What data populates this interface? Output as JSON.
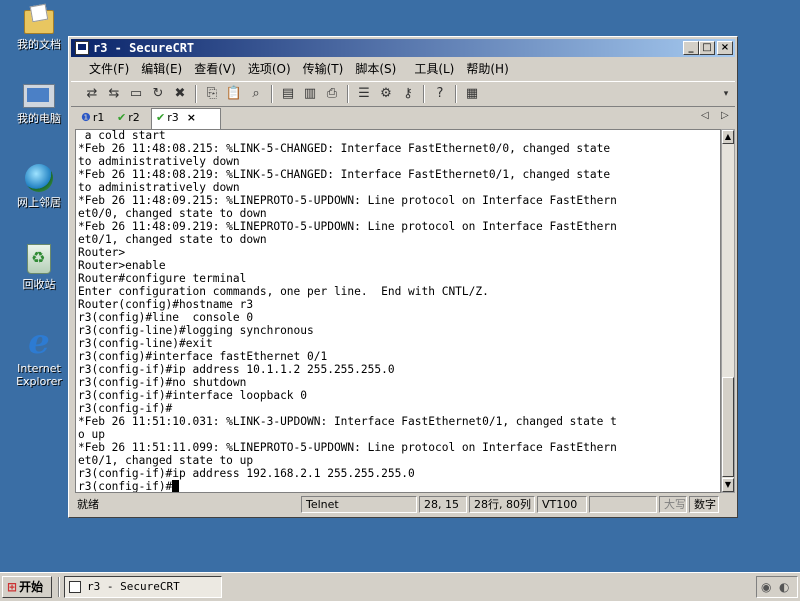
{
  "desktop": {
    "icons": [
      {
        "label": "我的文档",
        "icon": "my-documents-icon"
      },
      {
        "label": "我的电脑",
        "icon": "my-computer-icon"
      },
      {
        "label": "网上邻居",
        "icon": "network-places-icon"
      },
      {
        "label": "回收站",
        "icon": "recycle-bin-icon"
      },
      {
        "label": "Internet Explorer",
        "icon": "internet-explorer-icon"
      }
    ]
  },
  "window": {
    "title": "r3 - SecureCRT",
    "controls": {
      "minimize": "_",
      "maximize": "□",
      "close": "×"
    },
    "menu": [
      "文件(F)",
      "编辑(E)",
      "查看(V)",
      "选项(O)",
      "传输(T)",
      "脚本(S)",
      "工具(L)",
      "帮助(H)"
    ],
    "tabs": [
      {
        "label": "r1",
        "status": "info"
      },
      {
        "label": "r2",
        "status": "connected"
      },
      {
        "label": "r3",
        "status": "connected",
        "active": true,
        "close": "×"
      }
    ],
    "tab_nav": {
      "prev": "◁",
      "next": "▷"
    },
    "terminal_lines": [
      " a cold start",
      "*Feb 26 11:48:08.215: %LINK-5-CHANGED: Interface FastEthernet0/0, changed state",
      "to administratively down",
      "*Feb 26 11:48:08.219: %LINK-5-CHANGED: Interface FastEthernet0/1, changed state",
      "to administratively down",
      "*Feb 26 11:48:09.215: %LINEPROTO-5-UPDOWN: Line protocol on Interface FastEthern",
      "et0/0, changed state to down",
      "*Feb 26 11:48:09.219: %LINEPROTO-5-UPDOWN: Line protocol on Interface FastEthern",
      "et0/1, changed state to down",
      "Router>",
      "Router>enable",
      "Router#configure terminal",
      "Enter configuration commands, one per line.  End with CNTL/Z.",
      "Router(config)#hostname r3",
      "r3(config)#line  console 0",
      "r3(config-line)#logging synchronous",
      "r3(config-line)#exit",
      "r3(config)#interface fastEthernet 0/1",
      "r3(config-if)#ip address 10.1.1.2 255.255.255.0",
      "r3(config-if)#no shutdown",
      "r3(config-if)#interface loopback 0",
      "r3(config-if)#",
      "*Feb 26 11:51:10.031: %LINK-3-UPDOWN: Interface FastEthernet0/1, changed state t",
      "o up",
      "*Feb 26 11:51:11.099: %LINEPROTO-5-UPDOWN: Line protocol on Interface FastEthern",
      "et0/1, changed state to up",
      "r3(config-if)#ip address 192.168.2.1 255.255.255.0"
    ],
    "prompt_line": "r3(config-if)#",
    "status": {
      "ready": "就绪",
      "protocol": "Telnet",
      "cursor_pos": "28, 15",
      "size": "28行, 80列",
      "emulation": "VT100",
      "caps": "大写",
      "num": "数字"
    }
  },
  "taskbar": {
    "start_label": "开始",
    "task_label": "r3 - SecureCRT"
  }
}
